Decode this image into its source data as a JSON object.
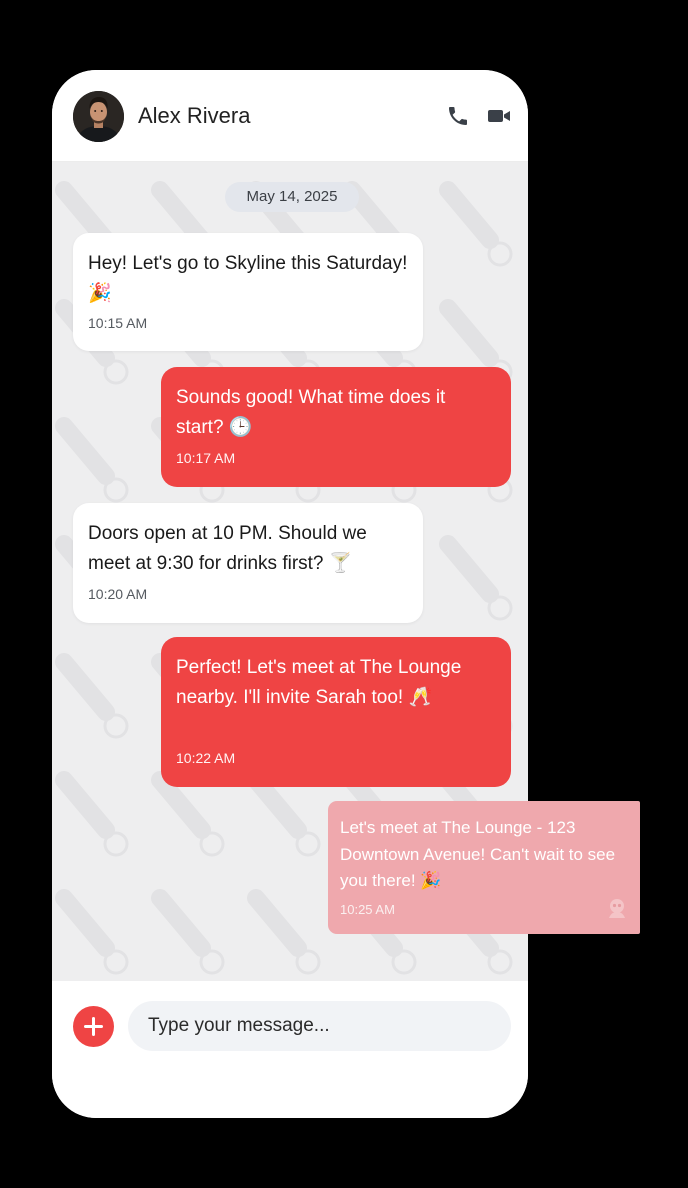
{
  "contact": {
    "name": "Alex Rivera"
  },
  "header_icons": {
    "call": "phone-icon",
    "video": "video-camera-icon"
  },
  "chat": {
    "date_divider": "May 14, 2025",
    "messages": [
      {
        "direction": "incoming",
        "text": "Hey! Let's go to Skyline this Saturday! 🎉",
        "time": "10:15 AM"
      },
      {
        "direction": "outgoing",
        "text": "Sounds good! What time does it start? 🕒",
        "time": "10:17 AM"
      },
      {
        "direction": "incoming",
        "text": "Doors open at 10 PM. Should we meet at 9:30 for drinks first? 🍸",
        "time": "10:20 AM"
      },
      {
        "direction": "outgoing",
        "text": "Perfect! Let's meet at The Lounge nearby. I'll invite Sarah too! 🥂",
        "time": "10:22 AM"
      }
    ],
    "floating_message": {
      "text": "Let's meet at The Lounge - 123 Downtown Avenue! Can't wait to see you there! 🎉",
      "time": "10:25 AM"
    }
  },
  "composer": {
    "placeholder": "Type your message...",
    "add_icon": "plus-icon"
  },
  "colors": {
    "accent": "#ef4444",
    "outgoing_bubble": "#ef4444",
    "incoming_bubble": "#ffffff",
    "chat_background": "#eeeeef",
    "floating_bubble": "#efa8ad"
  }
}
